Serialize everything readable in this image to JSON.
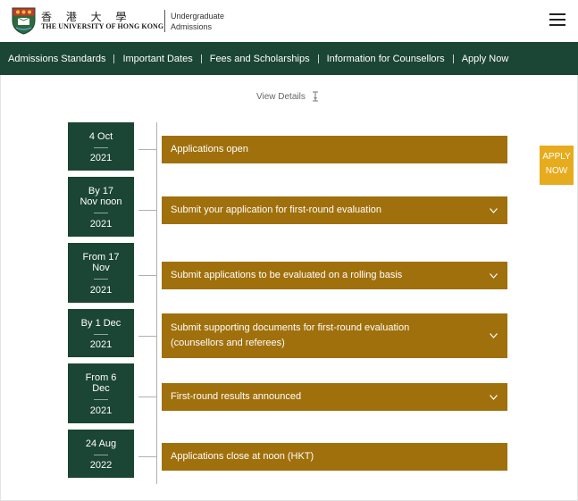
{
  "header": {
    "logo_chinese": "香 港 大 學",
    "logo_english": "THE UNIVERSITY OF HONG KONG",
    "site_name_line1": "Undergraduate",
    "site_name_line2": "Admissions",
    "menu_icon": "hamburger-menu-icon"
  },
  "nav": {
    "items": [
      {
        "label": "Admissions Standards"
      },
      {
        "label": "Important Dates"
      },
      {
        "label": "Fees and Scholarships"
      },
      {
        "label": "Information for Counsellors"
      },
      {
        "label": "Apply Now"
      }
    ]
  },
  "view_details": {
    "label": "View Details",
    "icon": "expand-icon"
  },
  "timeline": [
    {
      "date_line1": "4 Oct",
      "date_line2": "",
      "year": "2021",
      "event": "Applications open",
      "event_line2": "",
      "expandable": false
    },
    {
      "date_line1": "By 17",
      "date_line2": "Nov noon",
      "year": "2021",
      "event": "Submit your application for first-round evaluation",
      "event_line2": "",
      "expandable": true
    },
    {
      "date_line1": "From 17",
      "date_line2": "Nov",
      "year": "2021",
      "event": "Submit applications to be evaluated on a rolling basis",
      "event_line2": "",
      "expandable": true
    },
    {
      "date_line1": "By 1 Dec",
      "date_line2": "",
      "year": "2021",
      "event": "Submit supporting documents for first-round evaluation",
      "event_line2": "(counsellors and referees)",
      "expandable": true
    },
    {
      "date_line1": "From 6",
      "date_line2": "Dec",
      "year": "2021",
      "event": "First-round results announced",
      "event_line2": "",
      "expandable": true
    },
    {
      "date_line1": "24 Aug",
      "date_line2": "",
      "year": "2022",
      "event": "Applications close at noon (HKT)",
      "event_line2": "",
      "expandable": false
    }
  ],
  "apply_button": {
    "line1": "APPLY",
    "line2": "NOW"
  },
  "colors": {
    "brand_green": "#1b4534",
    "event_gold": "#a0700c",
    "apply_yellow": "#e6ac1e"
  }
}
